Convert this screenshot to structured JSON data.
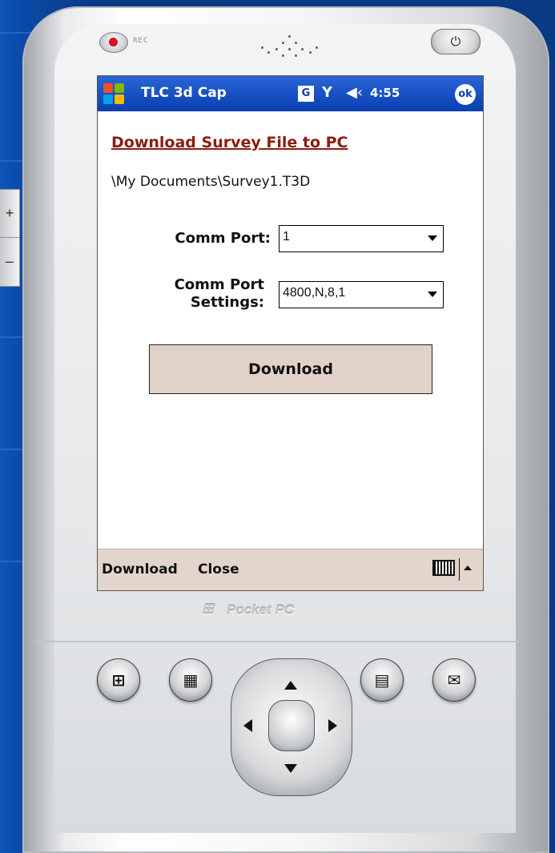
{
  "device": {
    "rec_label": "REC",
    "side_buttons": [
      "+",
      "–"
    ],
    "power_icon": "power-icon",
    "brand": "Pocket PC"
  },
  "statusbar": {
    "app_title": "TLC 3d Cap",
    "g_badge": "G",
    "time": "4:55",
    "ok": "ok"
  },
  "content": {
    "heading": "Download Survey File to PC",
    "file_path": "\\My Documents\\Survey1.T3D",
    "comm_port_label": "Comm Port:",
    "comm_port_value": "1",
    "settings_label_line1": "Comm Port",
    "settings_label_line2": "Settings:",
    "settings_value": "4800,N,8,1",
    "download_button": "Download"
  },
  "menubar": {
    "left": "Download",
    "right": "Close"
  },
  "colors": {
    "titlebar": "#0a3fb0",
    "heading": "#8b1d12",
    "button_bg": "#e1d2c9",
    "menubar_bg": "#e3d5cc"
  }
}
